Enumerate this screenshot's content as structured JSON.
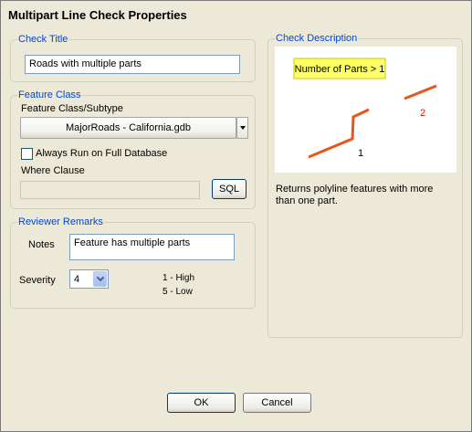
{
  "window": {
    "title": "Multipart Line Check Properties"
  },
  "check_title": {
    "group_label": "Check Title",
    "value": "Roads with multiple parts"
  },
  "feature_class": {
    "group_label": "Feature Class",
    "subtype_label": "Feature Class/Subtype",
    "selected": "MajorRoads -  California.gdb",
    "always_run_label": "Always Run on Full Database",
    "always_run_checked": false,
    "where_clause_label": "Where Clause",
    "where_clause_value": "",
    "sql_button": "SQL"
  },
  "reviewer_remarks": {
    "group_label": "Reviewer Remarks",
    "notes_label": "Notes",
    "notes_value": "Feature has multiple parts",
    "severity_label": "Severity",
    "severity_value": "4",
    "severity_high": "1 - High",
    "severity_low": "5 - Low"
  },
  "check_description": {
    "group_label": "Check Description",
    "diagram_callout": "Number of Parts > 1",
    "part_label_1": "1",
    "part_label_2": "2",
    "text": "Returns polyline features with more than one part.",
    "line_color": "#e8561a",
    "callout_color": "#ffff66",
    "label2_color": "#cc2200"
  },
  "buttons": {
    "ok": "OK",
    "cancel": "Cancel"
  }
}
